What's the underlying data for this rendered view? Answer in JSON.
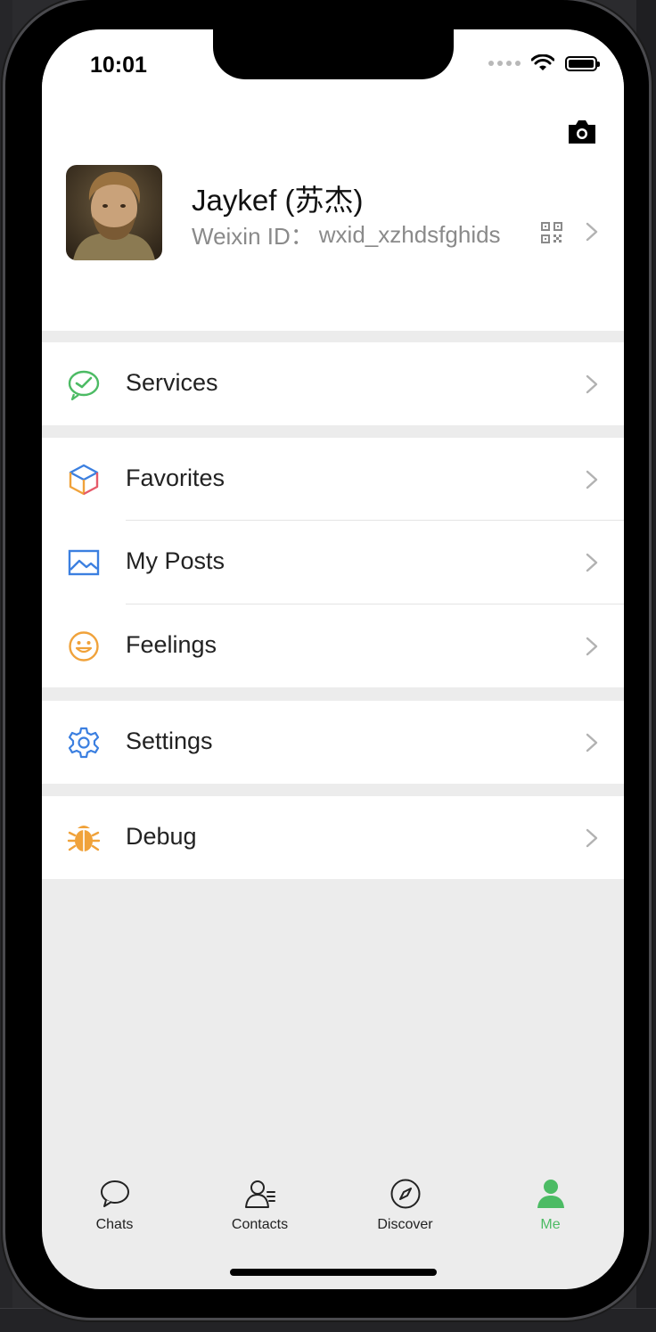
{
  "status": {
    "time": "10:01"
  },
  "profile": {
    "name": "Jaykef (苏杰)",
    "wxid_label": "Weixin ID：",
    "wxid_value": "wxid_xzhdsfghids"
  },
  "menu": {
    "services": "Services",
    "favorites": "Favorites",
    "my_posts": "My Posts",
    "feelings": "Feelings",
    "settings": "Settings",
    "debug": "Debug"
  },
  "tabs": [
    {
      "label": "Chats",
      "icon": "chat-bubble-icon"
    },
    {
      "label": "Contacts",
      "icon": "contacts-icon"
    },
    {
      "label": "Discover",
      "icon": "compass-icon"
    },
    {
      "label": "Me",
      "icon": "person-icon",
      "active": true
    }
  ],
  "colors": {
    "accent": "#4cbb64",
    "services": "#4cbb64",
    "posts": "#3b7fe0",
    "feelings": "#f0a23a",
    "settings": "#3b7fe0",
    "debug": "#f0a23a"
  }
}
